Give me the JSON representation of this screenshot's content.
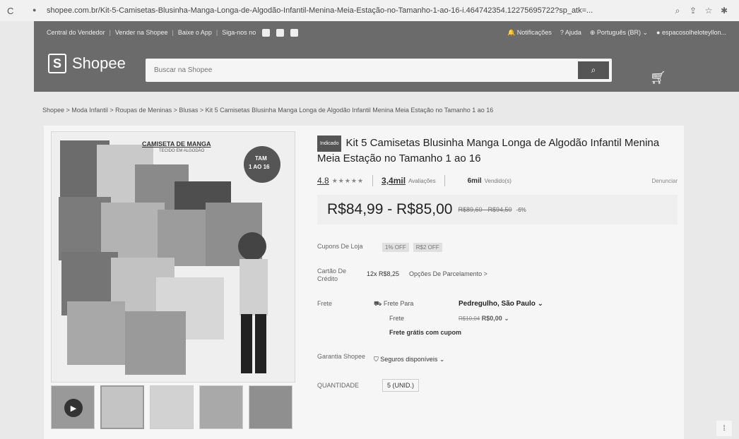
{
  "browser": {
    "url": "shopee.com.br/Kit-5-Camisetas-Blusinha-Manga-Longa-de-Algodão-Infantil-Menina-Meia-Estação-no-Tamanho-1-ao-16-i.464742354.12275695722?sp_atk=..."
  },
  "header": {
    "topnav_left": [
      "Central do Vendedor",
      "Vender na Shopee",
      "Baixe o App",
      "Siga-nos no"
    ],
    "notifications": "Notificações",
    "help": "Ajuda",
    "language": "Português (BR)",
    "user": "espacosolheloteyllon...",
    "logo_text": "Shopee",
    "search_placeholder": "Buscar na Shopee"
  },
  "breadcrumb": "Shopee > Moda Infantil > Roupas de Meninas > Blusas > Kit 5 Camisetas Blusinha Manga Longa de Algodão Infantil Menina Meia Estação no Tamanho 1 ao 16",
  "image_text": {
    "banner": "CAMISETA DE MANGA",
    "banner_sub": "TECIDO EM ALGODÃO",
    "tam": "TAM",
    "tam_range": "1 AO 16"
  },
  "product": {
    "badge": "Indicado",
    "title": "Kit 5 Camisetas Blusinha Manga Longa de Algodão Infantil Menina Meia Estação no Tamanho 1 ao 16",
    "rating": "4.8",
    "stars": "★★★★★",
    "reviews_count": "3,4mil",
    "reviews_label": "Avaliações",
    "sold_count": "6mil",
    "sold_label": "Vendido(s)",
    "report": "Denunciar",
    "price": "R$84,99 - R$85,00",
    "old_price": "R$89,60 - R$94,50",
    "discount": "-6%",
    "coupons_label": "Cupons De Loja",
    "coupons": [
      "1% OFF",
      "R$2 OFF"
    ],
    "card_label": "Cartão De Crédito",
    "installment": "12x R$8,25",
    "installment_options": "Opções De Parcelamento >",
    "shipping_label": "Frete",
    "free_shipping": "Frete Para",
    "location": "Pedregulho, São Paulo ⌄",
    "freight_label": "Frete",
    "freight_old": "R$10,04",
    "freight_new": "R$0,00 ⌄",
    "free_note": "Frete grátis com cupom",
    "guarantee_label": "Garantia Shopee",
    "guarantee_value": "Seguros disponíveis ⌄",
    "qty_label": "QUANTIDADE",
    "qty_value": "5 (UNID.)"
  },
  "colors": {
    "header_bg": "#6b6b6b",
    "page_bg": "#e9e9e9"
  }
}
